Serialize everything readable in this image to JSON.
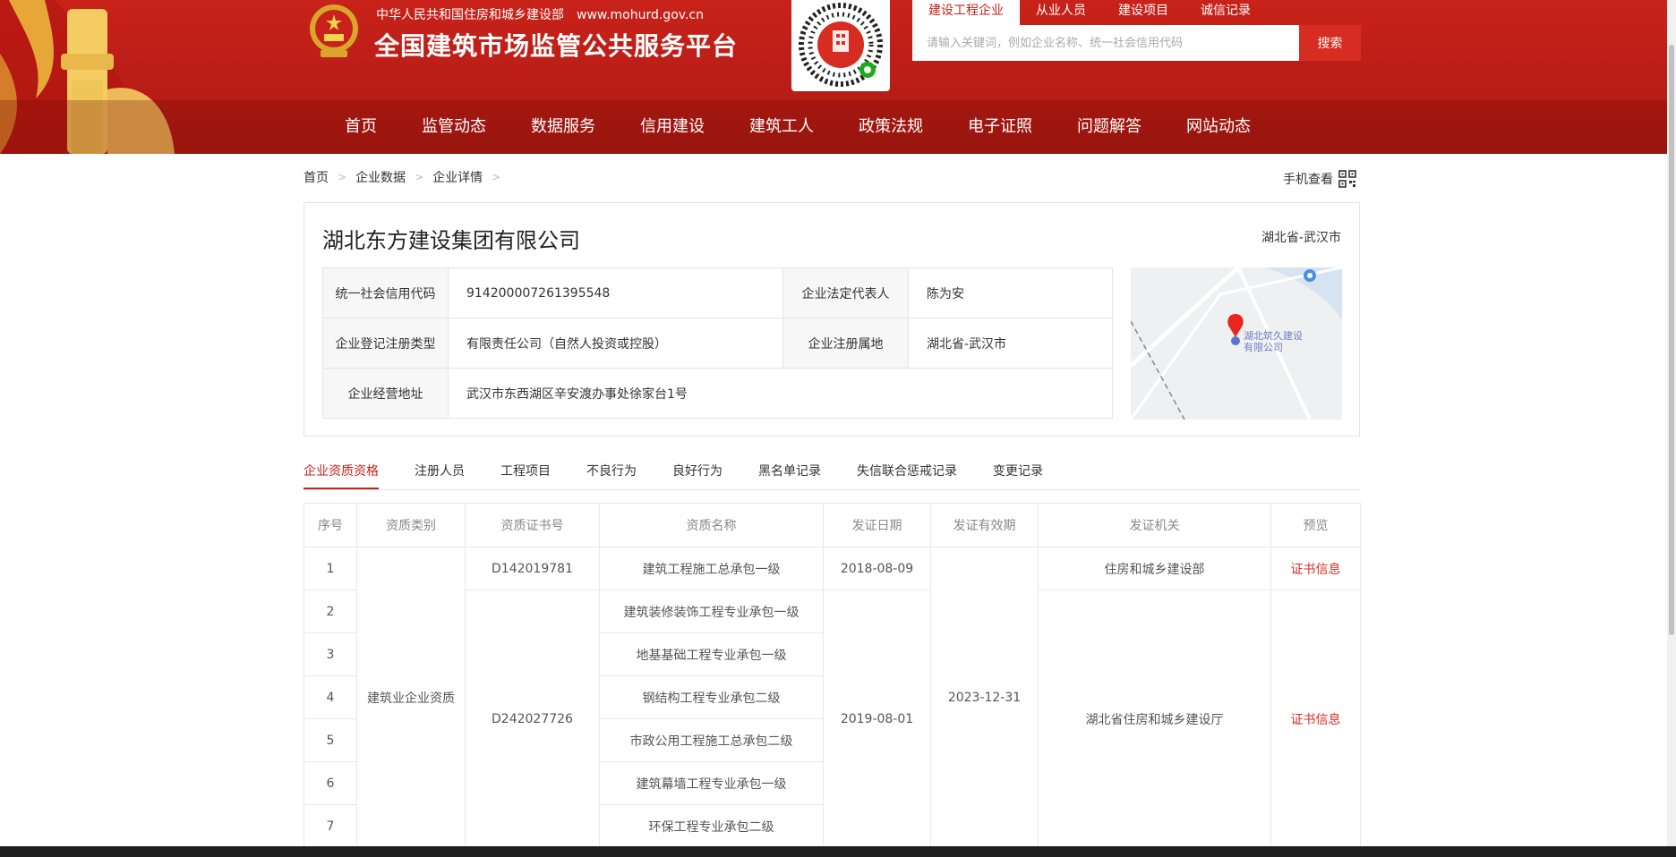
{
  "header": {
    "ministry": "中华人民共和国住房和城乡建设部",
    "url": "www.mohurd.gov.cn",
    "platform_title": "全国建筑市场监管公共服务平台",
    "brand_color": "#c8221a",
    "search_tabs": [
      {
        "label": "建设工程企业",
        "active": true
      },
      {
        "label": "从业人员",
        "active": false
      },
      {
        "label": "建设项目",
        "active": false
      },
      {
        "label": "诚信记录",
        "active": false
      }
    ],
    "search_placeholder": "请输入关键词，例如企业名称、统一社会信用代码",
    "search_button": "搜索",
    "nav": [
      "首页",
      "监管动态",
      "数据服务",
      "信用建设",
      "建筑工人",
      "政策法规",
      "电子证照",
      "问题解答",
      "网站动态"
    ]
  },
  "breadcrumb": [
    "首页",
    "企业数据",
    "企业详情"
  ],
  "mobile_view": "手机查看",
  "company": {
    "name": "湖北东方建设集团有限公司",
    "region": "湖北省-武汉市",
    "fields": {
      "credit_code_label": "统一社会信用代码",
      "credit_code": "914200007261395548",
      "legal_rep_label": "企业法定代表人",
      "legal_rep": "陈为安",
      "reg_type_label": "企业登记注册类型",
      "reg_type": "有限责任公司（自然人投资或控股）",
      "reg_place_label": "企业注册属地",
      "reg_place": "湖北省-武汉市",
      "address_label": "企业经营地址",
      "address": "武汉市东西湖区辛安渡办事处徐家台1号"
    },
    "map_label_line1": "湖北筑久建设",
    "map_label_line2": "有限公司"
  },
  "tabs": [
    {
      "label": "企业资质资格",
      "active": true
    },
    {
      "label": "注册人员",
      "active": false
    },
    {
      "label": "工程项目",
      "active": false
    },
    {
      "label": "不良行为",
      "active": false
    },
    {
      "label": "良好行为",
      "active": false
    },
    {
      "label": "黑名单记录",
      "active": false
    },
    {
      "label": "失信联合惩戒记录",
      "active": false
    },
    {
      "label": "变更记录",
      "active": false
    }
  ],
  "qualifications": {
    "headers": [
      "序号",
      "资质类别",
      "资质证书号",
      "资质名称",
      "发证日期",
      "发证有效期",
      "发证机关",
      "预览"
    ],
    "category": "建筑业企业资质",
    "validity": "2023-12-31",
    "cert1": {
      "number": "D142019781",
      "date": "2018-08-09",
      "authority": "住房和城乡建设部",
      "preview": "证书信息"
    },
    "cert2": {
      "number": "D242027726",
      "date": "2019-08-01",
      "authority": "湖北省住房和城乡建设厅",
      "preview": "证书信息"
    },
    "rows": [
      {
        "index": "1",
        "name": "建筑工程施工总承包一级"
      },
      {
        "index": "2",
        "name": "建筑装修装饰工程专业承包一级"
      },
      {
        "index": "3",
        "name": "地基基础工程专业承包一级"
      },
      {
        "index": "4",
        "name": "钢结构工程专业承包二级"
      },
      {
        "index": "5",
        "name": "市政公用工程施工总承包二级"
      },
      {
        "index": "6",
        "name": "建筑幕墙工程专业承包一级"
      },
      {
        "index": "7",
        "name": "环保工程专业承包二级"
      }
    ]
  }
}
